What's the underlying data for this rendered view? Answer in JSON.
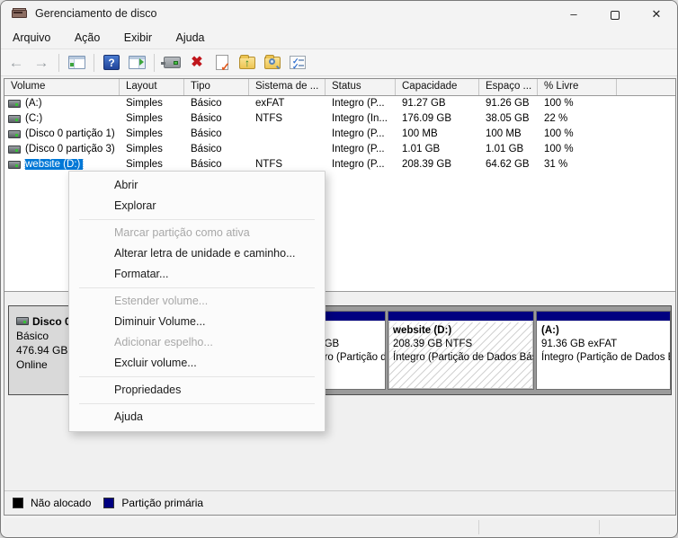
{
  "window": {
    "title": "Gerenciamento de disco",
    "controls": {
      "minimize": "–",
      "close": "✕"
    }
  },
  "menu_bar": {
    "items": [
      {
        "label": "Arquivo"
      },
      {
        "label": "Ação"
      },
      {
        "label": "Exibir"
      },
      {
        "label": "Ajuda"
      }
    ]
  },
  "toolbar": {
    "glyphs": {
      "back": "←",
      "forward": "→",
      "help": "?",
      "delete": "✖",
      "check": "✓",
      "up": "↑"
    },
    "icons": [
      "back-icon",
      "forward-icon",
      "console-tree-icon",
      "help-icon",
      "action-pane-icon",
      "scan-computer-icon",
      "delete-icon",
      "check-document-icon",
      "folder-up-icon",
      "folder-search-icon",
      "task-list-icon"
    ]
  },
  "volume_table": {
    "columns": [
      "Volume",
      "Layout",
      "Tipo",
      "Sistema de ...",
      "Status",
      "Capacidade",
      "Espaço ...",
      "% Livre",
      ""
    ],
    "rows": [
      {
        "volume": "(A:)",
        "layout": "Simples",
        "tipo": "Básico",
        "fs": "exFAT",
        "status": "Íntegro (P...",
        "capacidade": "91.27 GB",
        "espaco": "91.26 GB",
        "livre": "100 %"
      },
      {
        "volume": "(C:)",
        "layout": "Simples",
        "tipo": "Básico",
        "fs": "NTFS",
        "status": "Íntegro (In...",
        "capacidade": "176.09 GB",
        "espaco": "38.05 GB",
        "livre": "22 %"
      },
      {
        "volume": "(Disco 0 partição 1)",
        "layout": "Simples",
        "tipo": "Básico",
        "fs": "",
        "status": "Íntegro (P...",
        "capacidade": "100 MB",
        "espaco": "100 MB",
        "livre": "100 %"
      },
      {
        "volume": "(Disco 0 partição 3)",
        "layout": "Simples",
        "tipo": "Básico",
        "fs": "",
        "status": "Íntegro (P...",
        "capacidade": "1.01 GB",
        "espaco": "1.01 GB",
        "livre": "100 %"
      },
      {
        "volume": "website (D:)",
        "layout": "Simples",
        "tipo": "Básico",
        "fs": "NTFS",
        "status": "Íntegro (P...",
        "capacidade": "208.39 GB",
        "espaco": "64.62 GB",
        "livre": "31 %"
      }
    ]
  },
  "context_menu": {
    "items": [
      {
        "label": "Abrir",
        "enabled": true
      },
      {
        "label": "Explorar",
        "enabled": true
      },
      {
        "label": "Marcar partição como ativa",
        "enabled": false
      },
      {
        "label": "Alterar letra de unidade e caminho...",
        "enabled": true
      },
      {
        "label": "Formatar...",
        "enabled": true
      },
      {
        "label": "Estender volume...",
        "enabled": false
      },
      {
        "label": "Diminuir Volume...",
        "enabled": true
      },
      {
        "label": "Adicionar espelho...",
        "enabled": false
      },
      {
        "label": "Excluir volume...",
        "enabled": true
      },
      {
        "label": "Propriedades",
        "enabled": true
      },
      {
        "label": "Ajuda",
        "enabled": true
      }
    ]
  },
  "disk_panel": {
    "header": {
      "name": "Disco 0",
      "type": "Básico",
      "size": "476.94 GB",
      "status": "Online"
    },
    "partitions": [
      {
        "label": "",
        "size_line": "",
        "status_line": ""
      },
      {
        "label": "",
        "size_line": "",
        "status_line": ""
      },
      {
        "label": "",
        "size_line": "1.01 GB",
        "status_line": "Íntegro (Partição de Recuperação)"
      },
      {
        "label": "website  (D:)",
        "size_line": "208.39 GB NTFS",
        "status_line": "Íntegro (Partição de Dados Básica)"
      },
      {
        "label": "(A:)",
        "size_line": "91.36 GB exFAT",
        "status_line": "Íntegro (Partição de Dados Básica)"
      }
    ]
  },
  "legend": {
    "items": [
      {
        "label": "Não alocado",
        "color": "#000000"
      },
      {
        "label": "Partição primária",
        "color": "#000080"
      }
    ]
  },
  "colors": {
    "selection": "#0078d7",
    "primary_partition": "#000080",
    "unallocated": "#000000"
  }
}
